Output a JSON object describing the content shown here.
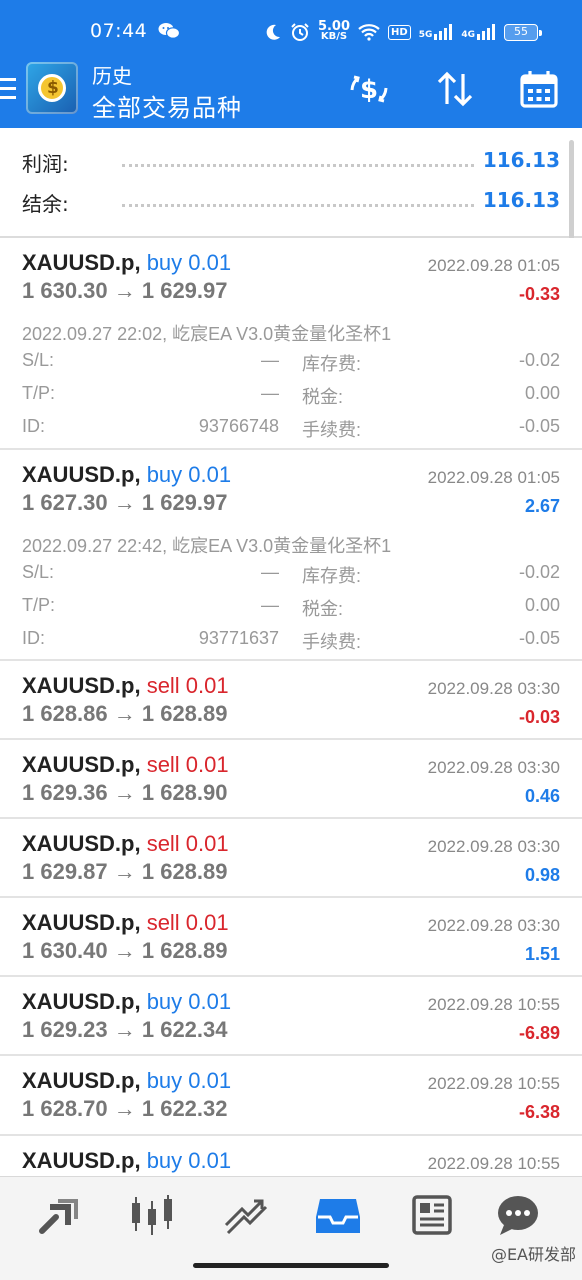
{
  "status_bar": {
    "time": "07:44",
    "net_speed": "5.00",
    "net_unit": "KB/S",
    "hd": "HD",
    "sig1": "5G",
    "sig2": "4G",
    "battery": "55"
  },
  "header": {
    "title": "历史",
    "subtitle": "全部交易品种"
  },
  "summary": {
    "profit_label": "利润:",
    "profit_value": "116.13",
    "balance_label": "结余:",
    "balance_value": "116.13"
  },
  "labels": {
    "sl": "S/L:",
    "tp": "T/P:",
    "id": "ID:",
    "swap": "库存费:",
    "tax": "税金:",
    "fee": "手续费:"
  },
  "deals": [
    {
      "symbol": "XAUUSD.p,",
      "type": "buy 0.01",
      "side": "buy",
      "close_time": "2022.09.28 01:05",
      "prices": "1 630.30 → 1 629.97",
      "profit": "-0.33",
      "profit_sign": "neg",
      "comment": "2022.09.27 22:02, 屹宸EA V3.0黄金量化圣杯1",
      "sl": "—",
      "tp": "—",
      "id": "93766748",
      "swap": "-0.02",
      "tax": "0.00",
      "fee": "-0.05"
    },
    {
      "symbol": "XAUUSD.p,",
      "type": "buy 0.01",
      "side": "buy",
      "close_time": "2022.09.28 01:05",
      "prices": "1 627.30 → 1 629.97",
      "profit": "2.67",
      "profit_sign": "pos",
      "comment": "2022.09.27 22:42, 屹宸EA V3.0黄金量化圣杯1",
      "sl": "—",
      "tp": "—",
      "id": "93771637",
      "swap": "-0.02",
      "tax": "0.00",
      "fee": "-0.05"
    },
    {
      "symbol": "XAUUSD.p,",
      "type": "sell 0.01",
      "side": "sell",
      "close_time": "2022.09.28 03:30",
      "prices": "1 628.86 → 1 628.89",
      "profit": "-0.03",
      "profit_sign": "neg"
    },
    {
      "symbol": "XAUUSD.p,",
      "type": "sell 0.01",
      "side": "sell",
      "close_time": "2022.09.28 03:30",
      "prices": "1 629.36 → 1 628.90",
      "profit": "0.46",
      "profit_sign": "pos"
    },
    {
      "symbol": "XAUUSD.p,",
      "type": "sell 0.01",
      "side": "sell",
      "close_time": "2022.09.28 03:30",
      "prices": "1 629.87 → 1 628.89",
      "profit": "0.98",
      "profit_sign": "pos"
    },
    {
      "symbol": "XAUUSD.p,",
      "type": "sell 0.01",
      "side": "sell",
      "close_time": "2022.09.28 03:30",
      "prices": "1 630.40 → 1 628.89",
      "profit": "1.51",
      "profit_sign": "pos"
    },
    {
      "symbol": "XAUUSD.p,",
      "type": "buy 0.01",
      "side": "buy",
      "close_time": "2022.09.28 10:55",
      "prices": "1 629.23 → 1 622.34",
      "profit": "-6.89",
      "profit_sign": "neg"
    },
    {
      "symbol": "XAUUSD.p,",
      "type": "buy 0.01",
      "side": "buy",
      "close_time": "2022.09.28 10:55",
      "prices": "1 628.70 → 1 622.32",
      "profit": "-6.38",
      "profit_sign": "neg"
    },
    {
      "symbol": "XAUUSD.p,",
      "type": "buy 0.01",
      "side": "buy",
      "close_time": "2022.09.28 10:55"
    }
  ],
  "bottom_nav": [
    "quotes-icon",
    "chart-icon",
    "trade-icon",
    "history-icon",
    "news-icon",
    "chat-icon"
  ],
  "watermark": "@EA研发部",
  "colors": {
    "header_bg": "#1e7ce8",
    "buy": "#1e7ce8",
    "sell": "#d9262d",
    "positive": "#1e7ce8",
    "negative": "#d9262d"
  }
}
